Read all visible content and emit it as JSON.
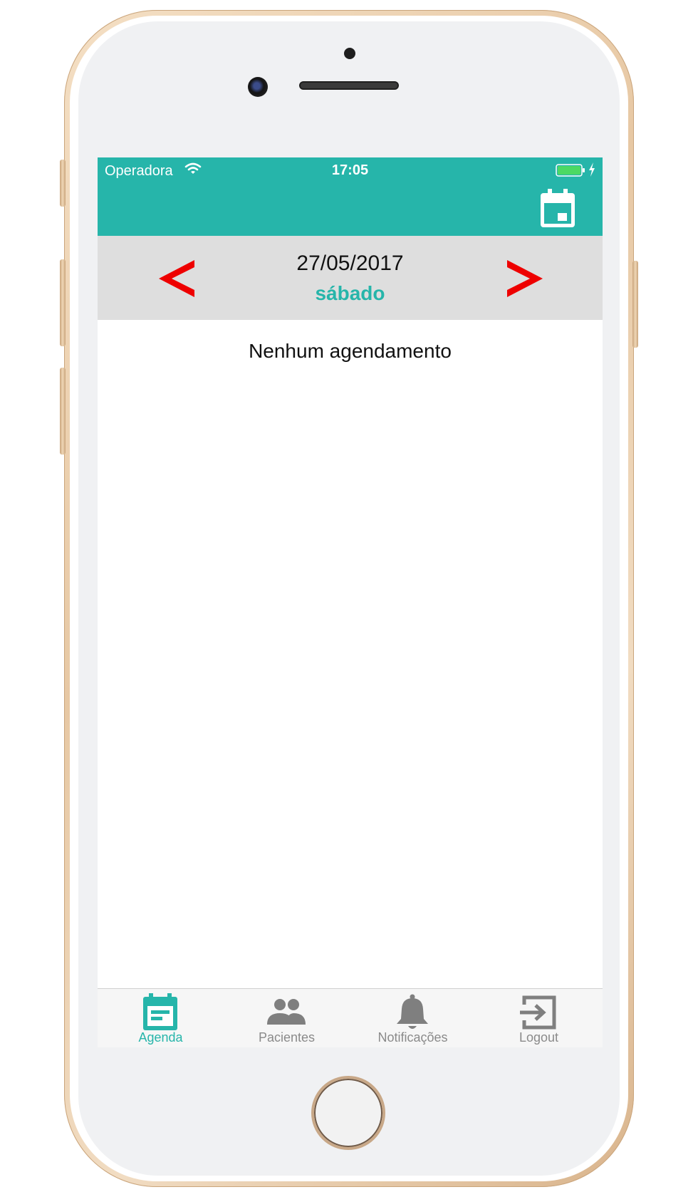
{
  "colors": {
    "accent": "#26b5aa",
    "nav_arrow": "#ee0000",
    "tab_inactive": "#8a8a8a",
    "date_bar": "#dedede"
  },
  "status_bar": {
    "carrier": "Operadora",
    "time": "17:05",
    "wifi_icon": "wifi-icon",
    "battery_icon": "battery-icon",
    "charging_icon": "bolt-icon"
  },
  "header": {
    "calendar_icon": "calendar-icon"
  },
  "date_nav": {
    "prev_icon": "chevron-left-icon",
    "next_icon": "chevron-right-icon",
    "date": "27/05/2017",
    "weekday": "sábado"
  },
  "content": {
    "empty_message": "Nenhum agendamento"
  },
  "tabs": [
    {
      "label": "Agenda",
      "icon": "agenda-icon",
      "active": true
    },
    {
      "label": "Pacientes",
      "icon": "people-icon",
      "active": false
    },
    {
      "label": "Notificações",
      "icon": "bell-icon",
      "active": false
    },
    {
      "label": "Logout",
      "icon": "logout-icon",
      "active": false
    }
  ]
}
